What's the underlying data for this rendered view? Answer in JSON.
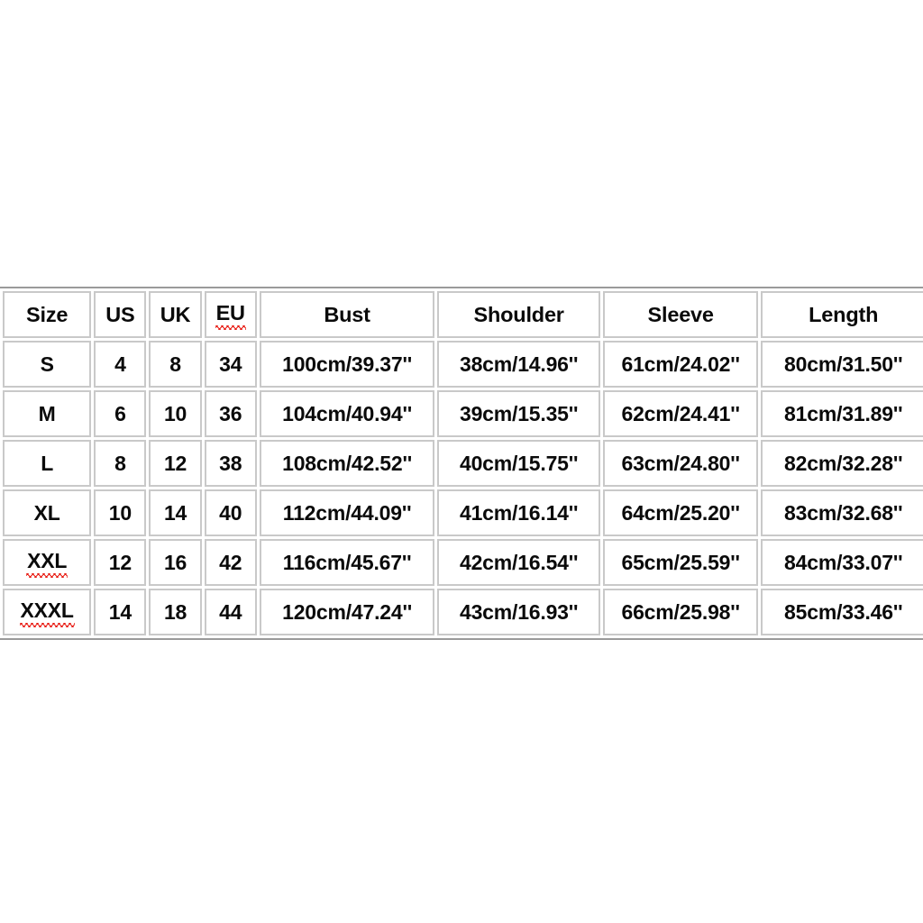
{
  "chart_data": {
    "type": "table",
    "title": "",
    "columns": [
      "Size",
      "US",
      "UK",
      "EU",
      "Bust",
      "Shoulder",
      "Sleeve",
      "Length"
    ],
    "misspelled_headers": [
      "EU"
    ],
    "misspelled_cells": [
      "XXL",
      "XXXL"
    ],
    "rows": [
      {
        "size": "S",
        "us": "4",
        "uk": "8",
        "eu": "34",
        "bust": "100cm/39.37''",
        "shoulder": "38cm/14.96''",
        "sleeve": "61cm/24.02''",
        "length": "80cm/31.50''"
      },
      {
        "size": "M",
        "us": "6",
        "uk": "10",
        "eu": "36",
        "bust": "104cm/40.94''",
        "shoulder": "39cm/15.35''",
        "sleeve": "62cm/24.41''",
        "length": "81cm/31.89''"
      },
      {
        "size": "L",
        "us": "8",
        "uk": "12",
        "eu": "38",
        "bust": "108cm/42.52''",
        "shoulder": "40cm/15.75''",
        "sleeve": "63cm/24.80''",
        "length": "82cm/32.28''"
      },
      {
        "size": "XL",
        "us": "10",
        "uk": "14",
        "eu": "40",
        "bust": "112cm/44.09''",
        "shoulder": "41cm/16.14''",
        "sleeve": "64cm/25.20''",
        "length": "83cm/32.68''"
      },
      {
        "size": "XXL",
        "us": "12",
        "uk": "16",
        "eu": "42",
        "bust": "116cm/45.67''",
        "shoulder": "42cm/16.54''",
        "sleeve": "65cm/25.59''",
        "length": "84cm/33.07''"
      },
      {
        "size": "XXXL",
        "us": "14",
        "uk": "18",
        "eu": "44",
        "bust": "120cm/47.24''",
        "shoulder": "43cm/16.93''",
        "sleeve": "66cm/25.98''",
        "length": "85cm/33.46''"
      }
    ],
    "colors": {
      "background": "#ffffff",
      "cell_border": "#c9c9c9",
      "outer_border": "#9a9a9a",
      "text": "#0a0a0a",
      "spellcheck_underline": "#e81b13"
    }
  }
}
